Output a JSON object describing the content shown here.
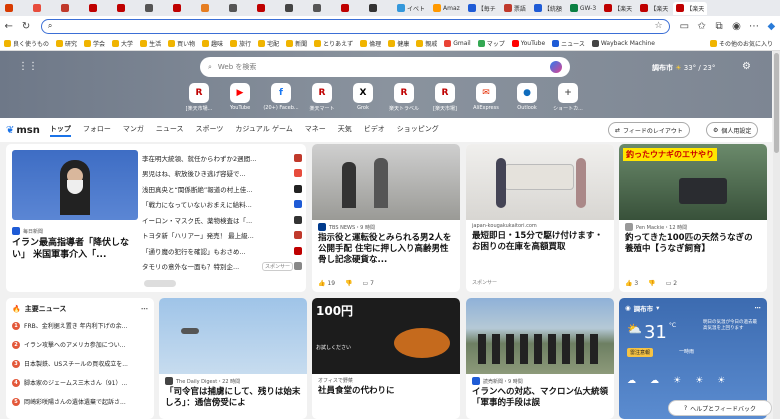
{
  "tabs": [
    "",
    "",
    "",
    "",
    "",
    "",
    "",
    "",
    "",
    "",
    "",
    "",
    "",
    "",
    "イベト",
    "Amaz",
    "【毎チ",
    "票語",
    "【統額",
    "GW-3",
    "【楽天",
    "【楽天",
    "【楽天"
  ],
  "address": {
    "placeholder": ""
  },
  "bookmarks": [
    "良く使うもの",
    "研究",
    "学会",
    "大学",
    "生活",
    "買い物",
    "趣味",
    "旅行",
    "宅配",
    "新聞",
    "とりあえず",
    "倫理",
    "健康",
    "親戚",
    "Gmail",
    "マップ",
    "YouTube",
    "ニュース",
    "Wayback Machine",
    "その他のお気に入り"
  ],
  "search": {
    "placeholder": "Web を検索"
  },
  "weather_top": {
    "city": "調布市",
    "temp": "33° / 23°"
  },
  "quick_links": [
    {
      "label": "[楽天市場...",
      "icon": "R",
      "color": "#bf0000"
    },
    {
      "label": "YouTube",
      "icon": "▶",
      "color": "#ff0000"
    },
    {
      "label": "(20+) Faceb...",
      "icon": "f",
      "color": "#1877f2"
    },
    {
      "label": "楽天マート",
      "icon": "R",
      "color": "#bf0000"
    },
    {
      "label": "Grok",
      "icon": "X",
      "color": "#000000"
    },
    {
      "label": "楽天トラベル",
      "icon": "R",
      "color": "#bf0000"
    },
    {
      "label": "[楽天市場]",
      "icon": "R",
      "color": "#bf0000"
    },
    {
      "label": "AliExpress",
      "icon": "✉",
      "color": "#e62e04"
    },
    {
      "label": "Outlook",
      "icon": "●",
      "color": "#0f6cbd"
    },
    {
      "label": "ショートカ...",
      "icon": "+",
      "color": "#555555"
    }
  ],
  "nav": {
    "logo": "msn",
    "items": [
      "トップ",
      "フォロー",
      "マンガ",
      "ニュース",
      "スポーツ",
      "カジュアル ゲーム",
      "マネー",
      "天気",
      "ビデオ",
      "ショッピング"
    ],
    "layout_btn": "フィードのレイアウト",
    "personal_btn": "個人用設定"
  },
  "headline": {
    "source": "毎日新聞",
    "title": "イラン最高指導者「降伏しない」 米国軍事介入「..."
  },
  "news_list": [
    "李在明大統領、就任からわずか2週間...",
    "男児はね、釈放後ひき逃げ容疑で...",
    "浅田真央と“関係断絶”報道の村上佳...",
    "「戦力になっていないおまえに給料...",
    "イーロン・マスク氏、薬物検査は「...",
    "トヨタ新「ハリアー」発売！ 最上級...",
    "「通り魔の犯行を確認」もおさめ...",
    "タモリの意外な一面も？特別企..."
  ],
  "sponsor": "スポンサー",
  "cards_row1": [
    {
      "source": "TBS NEWS・9 時間",
      "title": "指示役と運転役とみられる男2人を公開手配 住宅に押し入り高齢男性骨し記念硬貨な...",
      "likes": "19",
      "comments": "7"
    },
    {
      "source": "japan-kougakukaitori.com",
      "title": "最短即日・15分で駆け付けます・お困りの在庫を高額買取",
      "sponsor": "スポンサー"
    },
    {
      "source": "Pen Mackie・12 時間",
      "title": "釣ってきた100匹の天然うなぎの養殖中【うなぎ飼育】",
      "likes": "3",
      "comments": "2",
      "banner": "釣ったウナギのエサやり"
    }
  ],
  "main_news": {
    "title": "主要ニュース",
    "items": [
      "FRB、金利据え置き 年内利下げの余...",
      "イラン攻撃へのアメリカ参加につい...",
      "日本製鉄、USスチールの買収成立を...",
      "脚本家のジェームス三木さん（91）...",
      "岡崎彩咲陽さんの遺体遺棄で起訴さ..."
    ]
  },
  "cards_row2": [
    {
      "source": "The Daily Digest・22 時間",
      "title": "「司令官は捕虜にして、残りは始末しろ」：通信傍受によ"
    },
    {
      "source": "オフィスで野菜",
      "title": "社員食堂の代わりに",
      "banner": "100円",
      "sub": "お試しください"
    },
    {
      "source": "読売新聞・9 時間",
      "title": "イランへの対応、マクロン仏大統領「軍事的手段は誤"
    }
  ],
  "weather_card": {
    "city": "調布市",
    "temp": "31",
    "unit": "°C",
    "alert": "明日の気温が今日の過去最高気温を上回ります",
    "warning": "雷注意報",
    "cond": "一時雨"
  },
  "help": "ヘルプとフィードバック"
}
